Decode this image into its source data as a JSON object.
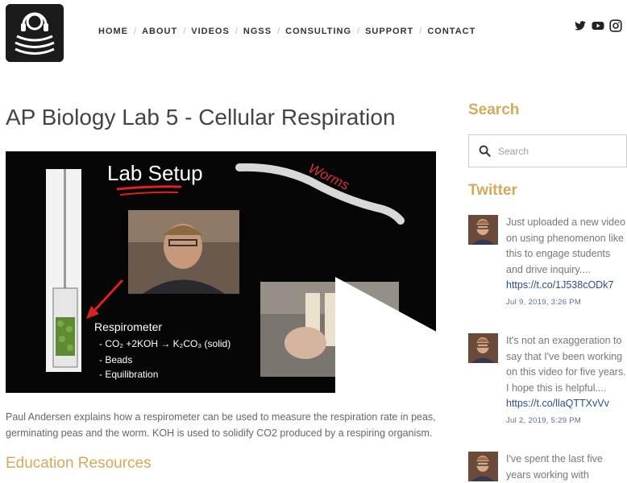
{
  "nav": {
    "items": [
      {
        "label": "HOME"
      },
      {
        "label": "ABOUT"
      },
      {
        "label": "VIDEOS"
      },
      {
        "label": "NGSS"
      },
      {
        "label": "CONSULTING"
      },
      {
        "label": "SUPPORT"
      },
      {
        "label": "CONTACT"
      }
    ]
  },
  "social": [
    "twitter-icon",
    "youtube-icon",
    "instagram-icon"
  ],
  "main": {
    "title": "AP Biology Lab 5 - Cellular Respiration",
    "video": {
      "heading": "Lab Setup",
      "worm_label": "Worms",
      "list_title": "Respirometer",
      "list_items": [
        "- CO₂ +2KOH → K₂CO₃ (solid)",
        "- Beads",
        "- Equilibration"
      ]
    },
    "description": "Paul Andersen explains how a respirometer can be used to measure the respiration rate in peas, germinating peas and the worm. KOH is used to solidify CO2 produced by a respiring organism.",
    "section_heading": "Education Resources"
  },
  "sidebar": {
    "search_heading": "Search",
    "search_placeholder": "Search",
    "twitter_heading": "Twitter",
    "tweets": [
      {
        "text": "Just uploaded a new video on using phenomenon like this to engage students and drive inquiry....",
        "link": "https://t.co/1J538cODk7",
        "date": "Jul 9, 2019, 3:26 PM"
      },
      {
        "text": "It's not an exaggeration to say that I've been working on this video for five years. I hope this is helpful....",
        "link": "https://t.co/llaQTTXvVv",
        "date": "Jul 2, 2019, 5:29 PM"
      },
      {
        "text": "I've spent the last five years working with",
        "link": "",
        "date": ""
      }
    ]
  },
  "colors": {
    "accent": "#d4a95a",
    "link": "#2a4e8a",
    "date": "#5a6e8a"
  }
}
